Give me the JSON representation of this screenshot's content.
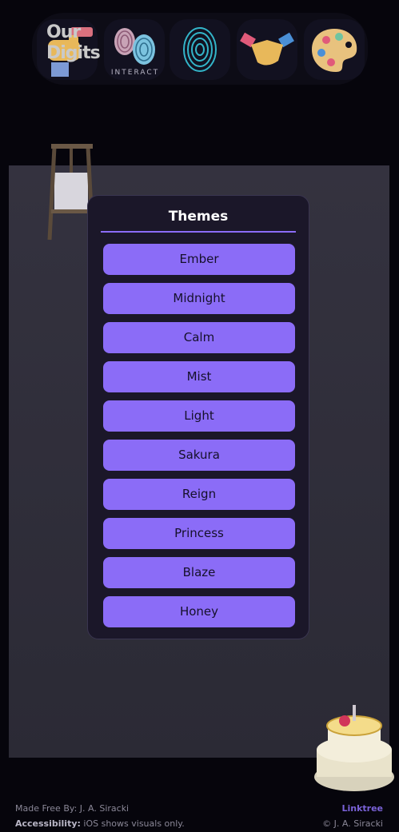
{
  "nav": {
    "logo_line1": "Our",
    "logo_line2": "Digits",
    "interact_label": "INTERACT"
  },
  "icons": {
    "logo": "logo-hand-icon",
    "interact": "fingerprints-icon",
    "fingerprint": "fingerprint-icon",
    "handshake": "handshake-icon",
    "palette": "palette-icon",
    "easel": "easel-icon",
    "cake": "cake-icon"
  },
  "modal": {
    "title": "Themes",
    "themes": [
      "Ember",
      "Midnight",
      "Calm",
      "Mist",
      "Light",
      "Sakura",
      "Reign",
      "Princess",
      "Blaze",
      "Honey"
    ]
  },
  "footer": {
    "made_by": "Made Free By: J. A. Siracki",
    "accessibility_label": "Accessibility:",
    "accessibility_text": " iOS shows visuals only.",
    "link": "Linktree",
    "copyright": "© J. A. Siracki"
  },
  "colors": {
    "accent": "#8b6cf7",
    "background": "#06050c",
    "modal_bg": "#1b1729"
  }
}
